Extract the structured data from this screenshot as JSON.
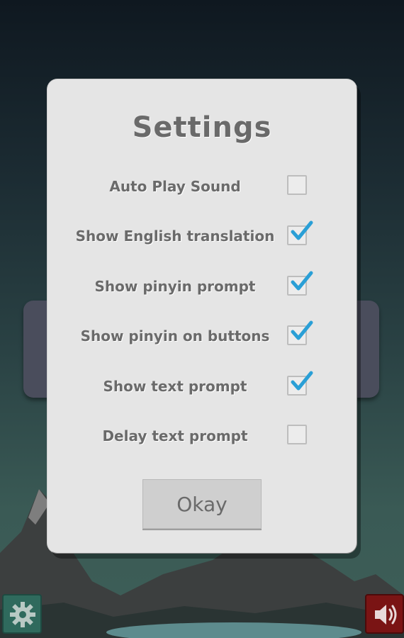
{
  "dialog": {
    "title": "Settings",
    "settings": [
      {
        "label": "Auto Play Sound",
        "checked": false
      },
      {
        "label": "Show English translation",
        "checked": true
      },
      {
        "label": "Show pinyin prompt",
        "checked": true
      },
      {
        "label": "Show pinyin on buttons",
        "checked": true
      },
      {
        "label": "Show text prompt",
        "checked": true
      },
      {
        "label": "Delay text prompt",
        "checked": false
      }
    ],
    "okay_label": "Okay"
  },
  "toolbar": {
    "settings_icon": "gear-icon",
    "sound_icon": "speaker-icon"
  },
  "colors": {
    "checkmark": "#2a9fd6",
    "dialog_bg": "#e5e5e5",
    "text": "#6a6a6a"
  }
}
